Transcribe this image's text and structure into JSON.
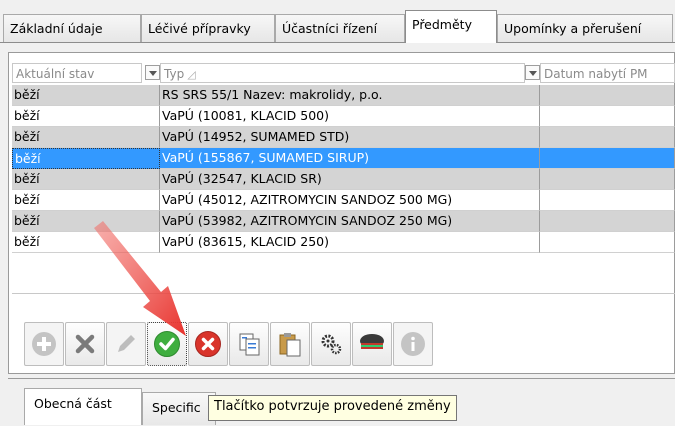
{
  "tabs": [
    {
      "label": "Základní údaje",
      "active": false
    },
    {
      "label": "Léčivé přípravky",
      "active": false
    },
    {
      "label": "Účastníci řízení",
      "active": false
    },
    {
      "label": "Předměty",
      "active": true
    },
    {
      "label": "Upomínky a přerušení",
      "active": false
    }
  ],
  "table": {
    "columns": [
      {
        "label": "Aktuální stav",
        "filter": true
      },
      {
        "label": "Typ",
        "filter": false,
        "sort_icon": "sort-triangle-icon"
      },
      {
        "label": "Datum nabytí PM",
        "filter": true
      }
    ],
    "rows": [
      {
        "status": "běží",
        "type": "RS SRS 55/1 Nazev: makrolidy, p.o.",
        "date": "",
        "style": "gray"
      },
      {
        "status": "běží",
        "type": "VaPÚ (10081, KLACID 500)",
        "date": "",
        "style": "white"
      },
      {
        "status": "běží",
        "type": "VaPÚ (14952, SUMAMED STD)",
        "date": "",
        "style": "gray"
      },
      {
        "status": "běží",
        "type": "VaPÚ (155867, SUMAMED SIRUP)",
        "date": "",
        "style": "selected"
      },
      {
        "status": "běží",
        "type": "VaPÚ (32547, KLACID SR)",
        "date": "",
        "style": "gray"
      },
      {
        "status": "běží",
        "type": "VaPÚ (45012, AZITROMYCIN SANDOZ 500 MG)",
        "date": "",
        "style": "white"
      },
      {
        "status": "běží",
        "type": "VaPÚ (53982, AZITROMYCIN SANDOZ 250 MG)",
        "date": "",
        "style": "gray"
      },
      {
        "status": "běží",
        "type": "VaPÚ (83615, KLACID 250)",
        "date": "",
        "style": "white"
      }
    ]
  },
  "toolbar": {
    "buttons": [
      {
        "name": "add-button",
        "icon": "plus-circle-icon",
        "enabled": false
      },
      {
        "name": "delete-button",
        "icon": "x-icon",
        "enabled": true
      },
      {
        "name": "edit-button",
        "icon": "pencil-icon",
        "enabled": false
      },
      {
        "name": "confirm-button",
        "icon": "check-circle-icon",
        "enabled": true
      },
      {
        "name": "cancel-button",
        "icon": "x-circle-icon",
        "enabled": true
      },
      {
        "name": "copy-button",
        "icon": "copy-icon",
        "enabled": true
      },
      {
        "name": "paste-button",
        "icon": "paste-icon",
        "enabled": true
      },
      {
        "name": "settings-button",
        "icon": "gears-icon",
        "enabled": true
      },
      {
        "name": "group-button",
        "icon": "group-icon",
        "enabled": true
      },
      {
        "name": "info-button",
        "icon": "info-icon",
        "enabled": false
      }
    ]
  },
  "bottom_tabs": [
    {
      "label": "Obecná část",
      "active": true
    },
    {
      "label": "Specific",
      "active": false
    }
  ],
  "tooltip": {
    "text": "Tlačítko potvrzuje provedené změny"
  },
  "colors": {
    "selection": "#3399ff",
    "row_gray": "#d4d4d4",
    "confirm_green": "#3fae3f",
    "cancel_red": "#d9342b",
    "arrow_red": "#e8322d",
    "tooltip_bg": "#ffffe1"
  }
}
